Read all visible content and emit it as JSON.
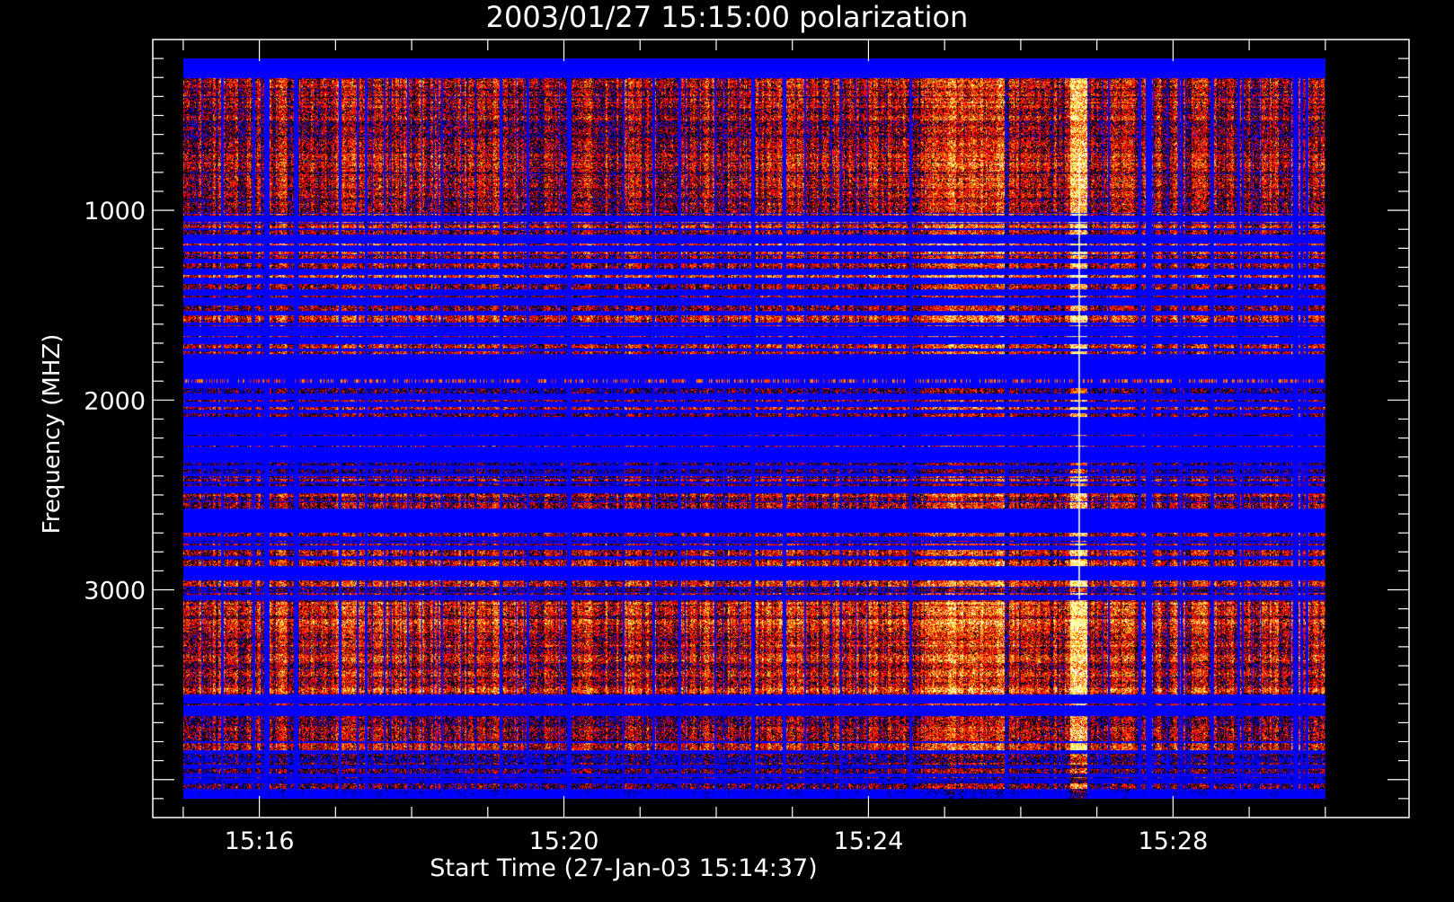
{
  "chart_data": {
    "type": "heatmap",
    "title": "2003/01/27 15:15:00 polarization",
    "xlabel": "Start Time (27-Jan-03 15:14:37)",
    "ylabel": "Frequency (MHZ)",
    "x_ticks": [
      "15:16",
      "15:20",
      "15:24",
      "15:28"
    ],
    "x_tick_minutes": [
      16,
      20,
      24,
      28
    ],
    "x_range_minutes": [
      14.6,
      31.1
    ],
    "x_data_range_minutes": [
      15.0,
      30.0
    ],
    "y_ticks": [
      "1000",
      "2000",
      "3000"
    ],
    "y_tick_values": [
      1000,
      2000,
      3000
    ],
    "y_range": [
      100,
      4200
    ],
    "y_data_range": [
      200,
      4100
    ],
    "inverted_y": true,
    "colormap": [
      "#0000ff",
      "#000000",
      "#ff0000",
      "#ff8c00",
      "#ffff66",
      "#ffffff"
    ],
    "background": "#000000",
    "axis_color": "#ffffff",
    "features": {
      "burst_time_minute": 26.75,
      "gap_band_mhz": [
        1810,
        1890
      ],
      "active_interval_minutes": [
        24.8,
        25.8
      ]
    }
  }
}
